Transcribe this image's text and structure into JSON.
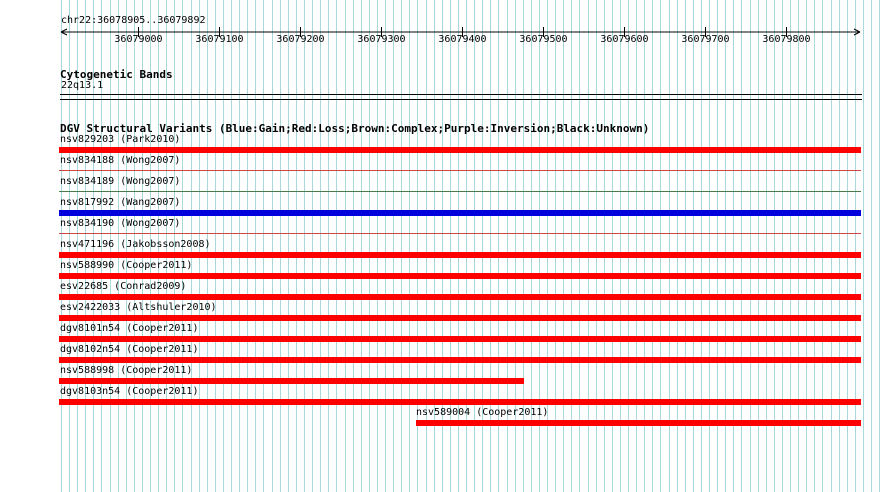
{
  "ruler": {
    "location": "chr22:36078905..36079892",
    "start": 36078905,
    "end": 36079892,
    "ticks": [
      "36079000",
      "36079100",
      "36079200",
      "36079300",
      "36079400",
      "36079500",
      "36079600",
      "36079700",
      "36079800"
    ]
  },
  "cytoband": {
    "title": "Cytogenetic Bands",
    "band": "22q13.1"
  },
  "dgv": {
    "title": "DGV Structural Variants (Blue:Gain;Red:Loss;Brown:Complex;Purple:Inversion;Black:Unknown)",
    "colors": {
      "loss": "#ff0000",
      "gain": "#0000dd",
      "separator_loss": "#cc4444",
      "separator_other": "#4a7a4a",
      "grid": "#a8d8dc"
    },
    "variants": [
      {
        "id": "nsv829203",
        "label": "nsv829203 (Park2010)",
        "type": "loss",
        "start": 36078905,
        "end": 36079892,
        "bar_visible": true
      },
      {
        "id": "nsv834188",
        "label": "nsv834188 (Wong2007)",
        "type": "loss",
        "start": 36078905,
        "end": 36079892,
        "bar_visible": false
      },
      {
        "id": "nsv834189",
        "label": "nsv834189 (Wong2007)",
        "type": "other",
        "start": 36078905,
        "end": 36079892,
        "bar_visible": false
      },
      {
        "id": "nsv817992",
        "label": "nsv817992 (Wang2007)",
        "type": "gain",
        "start": 36078905,
        "end": 36079892,
        "bar_visible": true
      },
      {
        "id": "nsv834190",
        "label": "nsv834190 (Wong2007)",
        "type": "loss",
        "start": 36078905,
        "end": 36079892,
        "bar_visible": false
      },
      {
        "id": "nsv471196",
        "label": "nsv471196 (Jakobsson2008)",
        "type": "loss",
        "start": 36078905,
        "end": 36079892,
        "bar_visible": true
      },
      {
        "id": "nsv588990",
        "label": "nsv588990 (Cooper2011)",
        "type": "loss",
        "start": 36078905,
        "end": 36079892,
        "bar_visible": true
      },
      {
        "id": "esv22685",
        "label": "esv22685 (Conrad2009)",
        "type": "loss",
        "start": 36078905,
        "end": 36079892,
        "bar_visible": true
      },
      {
        "id": "esv2422033",
        "label": "esv2422033 (Altshuler2010)",
        "type": "loss",
        "start": 36078905,
        "end": 36079892,
        "bar_visible": true
      },
      {
        "id": "dgv8101n54",
        "label": "dgv8101n54 (Cooper2011)",
        "type": "loss",
        "start": 36078905,
        "end": 36079892,
        "bar_visible": true
      },
      {
        "id": "dgv8102n54",
        "label": "dgv8102n54 (Cooper2011)",
        "type": "loss",
        "start": 36078905,
        "end": 36079892,
        "bar_visible": true
      },
      {
        "id": "nsv588998",
        "label": "nsv588998 (Cooper2011)",
        "type": "loss",
        "start": 36078905,
        "end": 36079476,
        "bar_visible": true
      },
      {
        "id": "dgv8103n54",
        "label": "dgv8103n54 (Cooper2011)",
        "type": "loss",
        "start": 36078905,
        "end": 36079892,
        "bar_visible": true
      },
      {
        "id": "nsv589004",
        "label": "nsv589004 (Cooper2011)",
        "type": "loss",
        "start": 36079344,
        "end": 36079892,
        "bar_visible": true
      }
    ]
  }
}
